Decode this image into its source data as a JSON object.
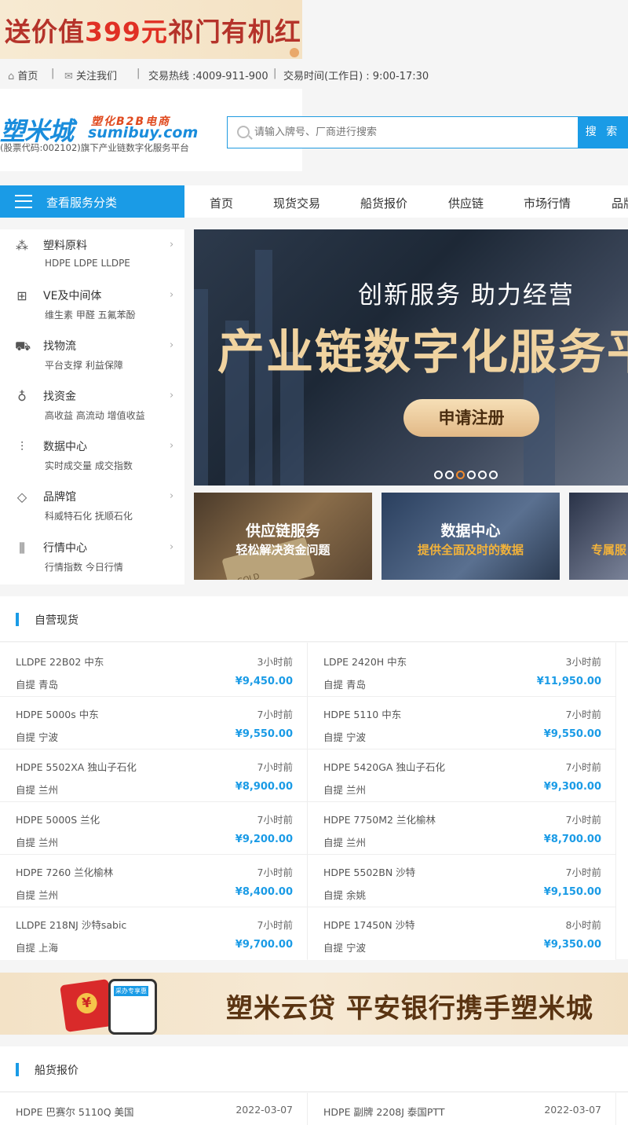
{
  "top_ad": {
    "pre": "送价值",
    "num": "399元",
    "post": "祁门有机红"
  },
  "topbar": {
    "home": "首页",
    "follow": "关注我们",
    "hotline": "交易热线 :4009-911-900",
    "hours": "交易时间(工作日) : 9:00-17:30",
    "sep": "|"
  },
  "logo": {
    "cn": "塑米城",
    "b2b": "塑化B2B电商",
    "en": "sumibuy.com",
    "sub": "(股票代码:002102)旗下产业链数字化服务平台"
  },
  "search": {
    "placeholder": "请输入牌号、厂商进行搜索",
    "button": "搜 索"
  },
  "category_button": "查看服务分类",
  "nav": [
    "首页",
    "现货交易",
    "船货报价",
    "供应链",
    "市场行情",
    "品牌"
  ],
  "sidebar": [
    {
      "icon": "plastic-granules-icon",
      "title": "塑料原料",
      "sub": "HDPE LDPE LLDPE"
    },
    {
      "icon": "medical-box-icon",
      "title": "VE及中间体",
      "sub": "维生素 甲醛 五氟苯酚"
    },
    {
      "icon": "truck-icon",
      "title": "找物流",
      "sub": "平台支撑 利益保障"
    },
    {
      "icon": "money-bag-icon",
      "title": "找资金",
      "sub": "高收益 高流动 增值收益"
    },
    {
      "icon": "bar-chart-icon",
      "title": "数据中心",
      "sub": "实时成交量 成交指数"
    },
    {
      "icon": "diamond-icon",
      "title": "品牌馆",
      "sub": "科威特石化 抚顺石化"
    },
    {
      "icon": "line-chart-icon",
      "title": "行情中心",
      "sub": "行情指数 今日行情"
    }
  ],
  "banner": {
    "headline": "创新服务 助力经营",
    "title": "产业链数字化服务平",
    "cta": "申请注册",
    "slide_count": 6,
    "active_slide": 3
  },
  "cards": [
    {
      "title": "供应链服务",
      "subtitle": "轻松解决资金问题",
      "sub_color": "#ffffff",
      "card_text": "GOLD"
    },
    {
      "title": "数据中心",
      "subtitle": "提供全面及时的数据",
      "sub_color": "#f2b23a"
    },
    {
      "title": "",
      "subtitle": "专属服",
      "sub_color": "#f2b23a"
    }
  ],
  "spot": {
    "title": "自营现货",
    "items": [
      {
        "name": "LLDPE 22B02 中东",
        "time": "3小时前",
        "loc": "自提 青岛",
        "price": "¥9,450.00"
      },
      {
        "name": "LDPE 2420H 中东",
        "time": "3小时前",
        "loc": "自提 青岛",
        "price": "¥11,950.00"
      },
      {
        "name": "HDPE 5000s 中东",
        "time": "7小时前",
        "loc": "自提 宁波",
        "price": "¥9,550.00"
      },
      {
        "name": "HDPE 5110 中东",
        "time": "7小时前",
        "loc": "自提 宁波",
        "price": "¥9,550.00"
      },
      {
        "name": "HDPE 5502XA 独山子石化",
        "time": "7小时前",
        "loc": "自提 兰州",
        "price": "¥8,900.00"
      },
      {
        "name": "HDPE 5420GA 独山子石化",
        "time": "7小时前",
        "loc": "自提 兰州",
        "price": "¥9,300.00"
      },
      {
        "name": "HDPE 5000S 兰化",
        "time": "7小时前",
        "loc": "自提 兰州",
        "price": "¥9,200.00"
      },
      {
        "name": "HDPE 7750M2 兰化榆林",
        "time": "7小时前",
        "loc": "自提 兰州",
        "price": "¥8,700.00"
      },
      {
        "name": "HDPE 7260 兰化榆林",
        "time": "7小时前",
        "loc": "自提 兰州",
        "price": "¥8,400.00"
      },
      {
        "name": "HDPE 5502BN 沙特",
        "time": "7小时前",
        "loc": "自提 余姚",
        "price": "¥9,150.00"
      },
      {
        "name": "LLDPE 218NJ 沙特sabic",
        "time": "7小时前",
        "loc": "自提 上海",
        "price": "¥9,700.00"
      },
      {
        "name": "HDPE 17450N 沙特",
        "time": "8小时前",
        "loc": "自提 宁波",
        "price": "¥9,350.00"
      }
    ]
  },
  "ad_bar": {
    "text": "塑米云贷 平安银行携手塑米城",
    "coin": "¥",
    "phone_label": "采办专享惠"
  },
  "ship": {
    "title": "船货报价",
    "items": [
      {
        "name": "HDPE 巴赛尔 5110Q 美国",
        "date": "2022-03-07"
      },
      {
        "name": "HDPE 副牌 2208J 泰国PTT",
        "date": "2022-03-07"
      }
    ]
  },
  "colors": {
    "accent": "#1a9be6",
    "price": "#1a9be6",
    "cta": "#e2b986"
  }
}
